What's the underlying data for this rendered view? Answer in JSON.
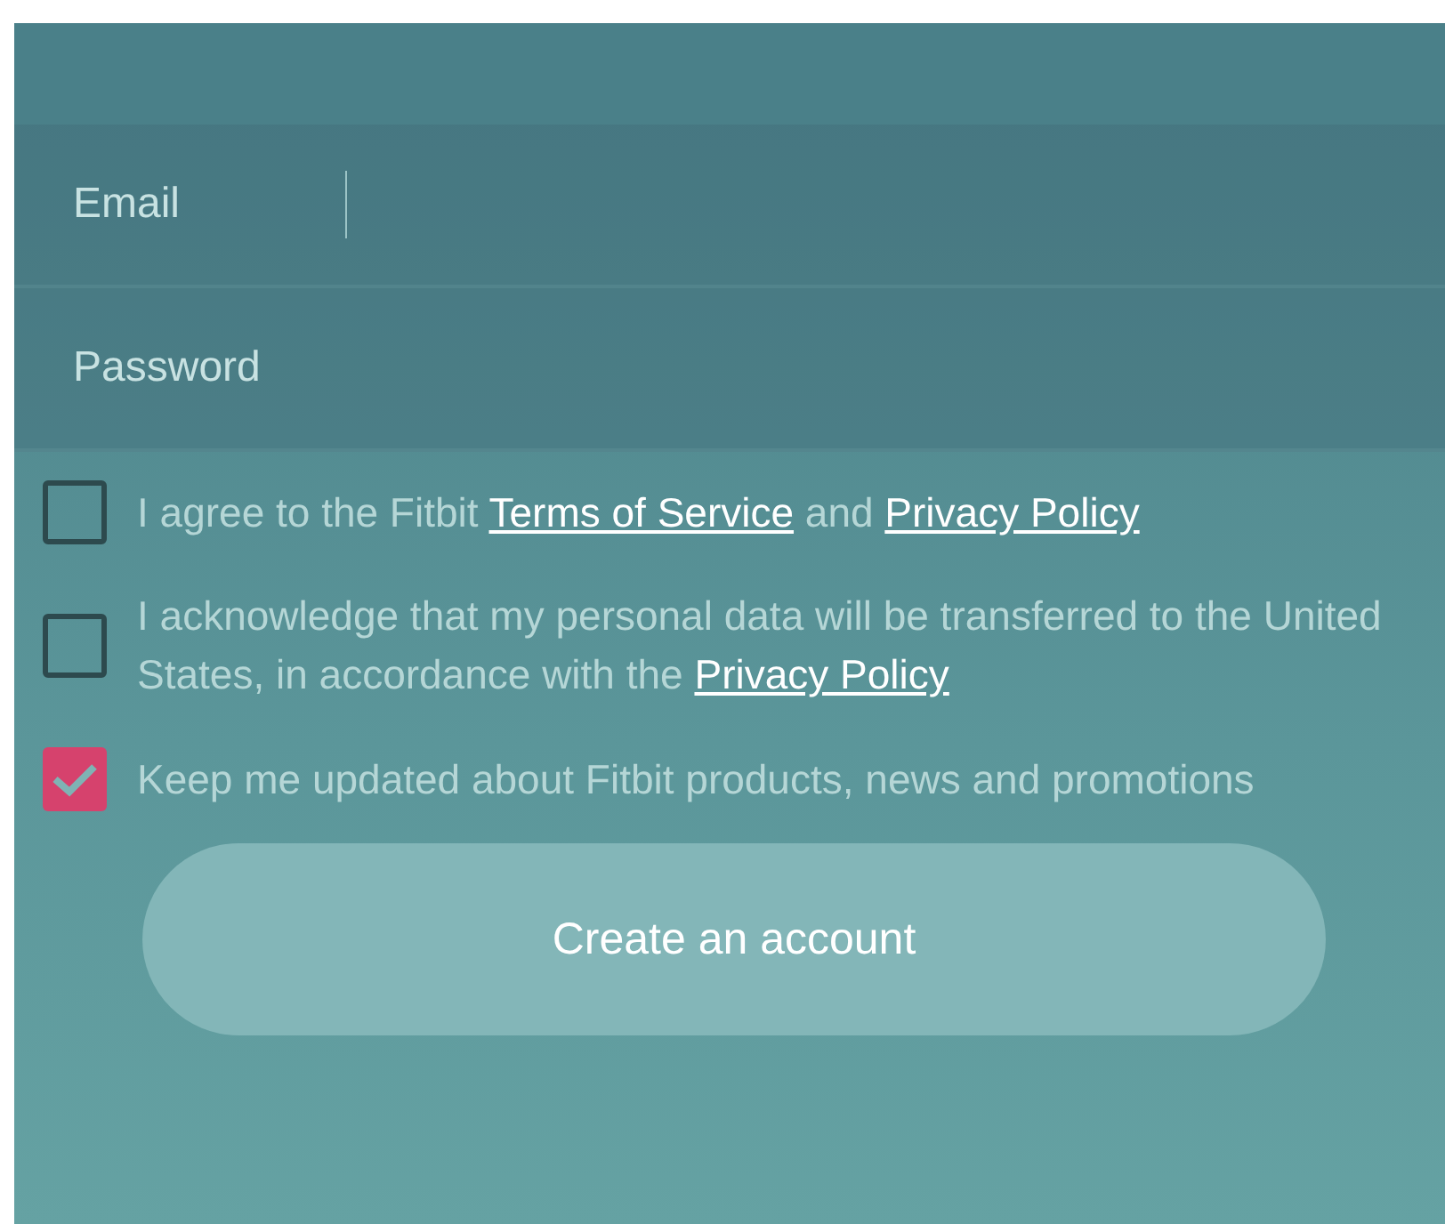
{
  "fields": [
    {
      "label": "Email",
      "focused": true
    },
    {
      "label": "Password",
      "focused": false
    }
  ],
  "checkboxes": [
    {
      "checked": false,
      "parts": [
        {
          "text": "I agree to the Fitbit ",
          "link": false
        },
        {
          "text": "Terms of Service",
          "link": true
        },
        {
          "text": " and ",
          "link": false
        },
        {
          "text": "Privacy Policy",
          "link": true
        }
      ]
    },
    {
      "checked": false,
      "parts": [
        {
          "text": "I acknowledge that my personal data will be transferred to the United States, in accordance with the ",
          "link": false
        },
        {
          "text": "Privacy Policy",
          "link": true
        }
      ]
    },
    {
      "checked": true,
      "parts": [
        {
          "text": "Keep me updated about Fitbit products, news and promotions",
          "link": false
        }
      ]
    }
  ],
  "submit": {
    "label": "Create an account"
  }
}
